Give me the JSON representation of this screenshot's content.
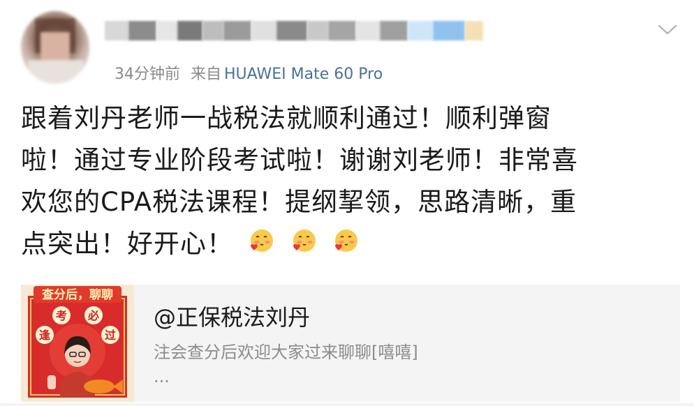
{
  "post": {
    "meta": {
      "time": "34分钟前",
      "from_label": "来自",
      "source": "HUAWEI Mate 60 Pro"
    },
    "text_lines": [
      "跟着刘丹老师一战税法就顺利通过！顺利弹窗",
      "啦！通过专业阶段考试啦！谢谢刘老师！非常喜",
      "欢您的CPA税法课程！提纲挈领，思路清晰，重",
      "点突出！好开心！"
    ],
    "emojis": [
      "love-emoji",
      "love-emoji",
      "love-emoji"
    ]
  },
  "card": {
    "title": "@正保税法刘丹",
    "description": "注会查分后欢迎大家过来聊聊[嘻嘻]",
    "more": "...",
    "thumb_banner": "查分后，聊聊",
    "thumb_chars": [
      "考",
      "必",
      "过",
      "逢"
    ]
  },
  "colors": {
    "link_blue": "#4c6f9a",
    "meta_gray": "#8a8a8a",
    "card_bg": "#f4f4f4"
  }
}
